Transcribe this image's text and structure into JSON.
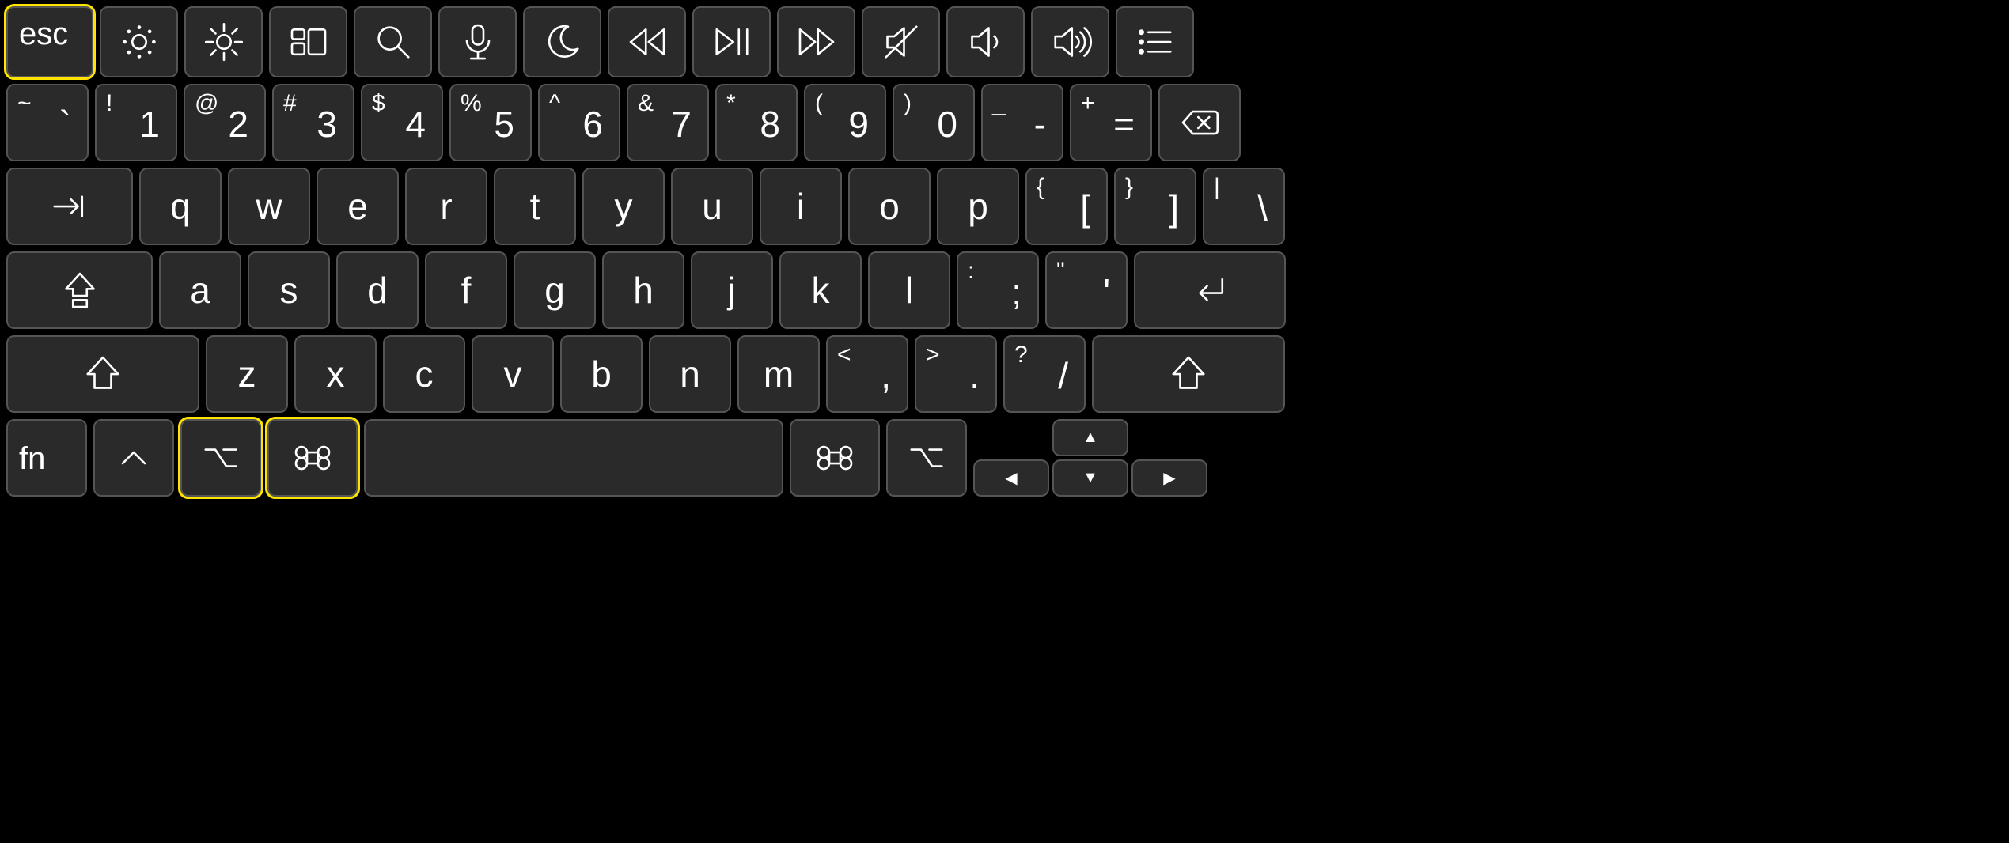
{
  "function_row": {
    "esc": "esc",
    "keys": [
      "brightness-down-icon",
      "brightness-up-icon",
      "mission-control-icon",
      "search-icon",
      "mic-icon",
      "moon-icon",
      "rewind-icon",
      "play-pause-icon",
      "fast-forward-icon",
      "mute-icon",
      "volume-down-icon",
      "volume-up-icon",
      "list-icon"
    ]
  },
  "number_row": [
    {
      "main": "`",
      "shift": "~"
    },
    {
      "main": "1",
      "shift": "!"
    },
    {
      "main": "2",
      "shift": "@"
    },
    {
      "main": "3",
      "shift": "#"
    },
    {
      "main": "4",
      "shift": "$"
    },
    {
      "main": "5",
      "shift": "%"
    },
    {
      "main": "6",
      "shift": "^"
    },
    {
      "main": "7",
      "shift": "&"
    },
    {
      "main": "8",
      "shift": "*"
    },
    {
      "main": "9",
      "shift": "("
    },
    {
      "main": "0",
      "shift": ")"
    },
    {
      "main": "-",
      "shift": "_"
    },
    {
      "main": "=",
      "shift": "+"
    }
  ],
  "backspace_icon": "backspace-icon",
  "tab_icon": "tab-icon",
  "qwerty_row": [
    "q",
    "w",
    "e",
    "r",
    "t",
    "y",
    "u",
    "i",
    "o",
    "p"
  ],
  "bracket_keys": [
    {
      "main": "[",
      "shift": "{"
    },
    {
      "main": "]",
      "shift": "}"
    },
    {
      "main": "\\",
      "shift": "|"
    }
  ],
  "caps_icon": "caps-lock-icon",
  "asdf_row": [
    "a",
    "s",
    "d",
    "f",
    "g",
    "h",
    "j",
    "k",
    "l"
  ],
  "semi_keys": [
    {
      "main": ";",
      "shift": ":"
    },
    {
      "main": "'",
      "shift": "\""
    }
  ],
  "return_icon": "return-icon",
  "shift_icon": "shift-icon",
  "zxcv_row": [
    "z",
    "x",
    "c",
    "v",
    "b",
    "n",
    "m"
  ],
  "comma_keys": [
    {
      "main": ",",
      "shift": "<"
    },
    {
      "main": ".",
      "shift": ">"
    },
    {
      "main": "/",
      "shift": "?"
    }
  ],
  "bottom": {
    "fn": "fn",
    "control_icon": "control-icon",
    "option_icon": "option-icon",
    "command_icon": "command-icon"
  },
  "arrows": {
    "up": "▲",
    "down": "▼",
    "left": "◀",
    "right": "▶"
  },
  "highlighted_keys": [
    "esc",
    "option-left",
    "command-left"
  ]
}
